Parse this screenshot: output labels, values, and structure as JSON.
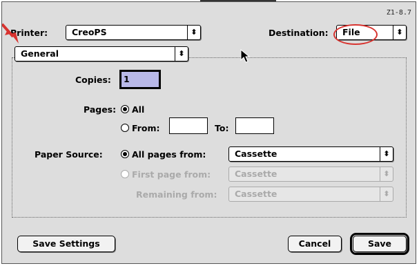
{
  "version_label": "Z1-8.7",
  "header": {
    "printer_label": "Printer:",
    "printer_value": "CreoPS",
    "destination_label": "Destination:",
    "destination_value": "File"
  },
  "section_popup": {
    "value": "General"
  },
  "copies": {
    "label": "Copies:",
    "value": "1"
  },
  "pages": {
    "label": "Pages:",
    "all_label": "All",
    "from_label": "From:",
    "to_label": "To:",
    "from_value": "",
    "to_value": ""
  },
  "paper_source": {
    "label": "Paper Source:",
    "all_pages_label": "All pages from:",
    "all_pages_value": "Cassette",
    "first_page_label": "First page from:",
    "first_page_value": "Cassette",
    "remaining_label": "Remaining from:",
    "remaining_value": "Cassette"
  },
  "buttons": {
    "save_settings": "Save Settings",
    "cancel": "Cancel",
    "save": "Save"
  },
  "stepper_glyph": "↕",
  "colors": {
    "annotation_red": "#d8332f",
    "dialog_background": "#dddddd",
    "focus_highlight": "#b8b8e8"
  }
}
